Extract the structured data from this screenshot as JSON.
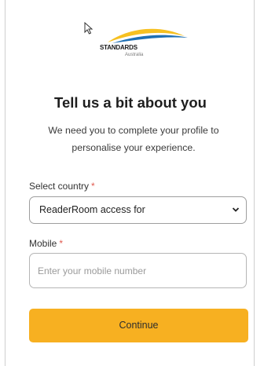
{
  "brand": {
    "name": "STANDARDS",
    "sub": "Australia",
    "colors": {
      "swoosh_yellow": "#f6c021",
      "swoosh_blue": "#1e6fb4",
      "button": "#f7b021"
    }
  },
  "form": {
    "heading": "Tell us a bit about you",
    "description": "We need you to complete your profile to personalise your experience.",
    "country": {
      "label": "Select country",
      "required_mark": "*",
      "selected": "ReaderRoom access for"
    },
    "mobile": {
      "label": "Mobile",
      "required_mark": "*",
      "value": "",
      "placeholder": "Enter your mobile number"
    },
    "continue_label": "Continue"
  }
}
